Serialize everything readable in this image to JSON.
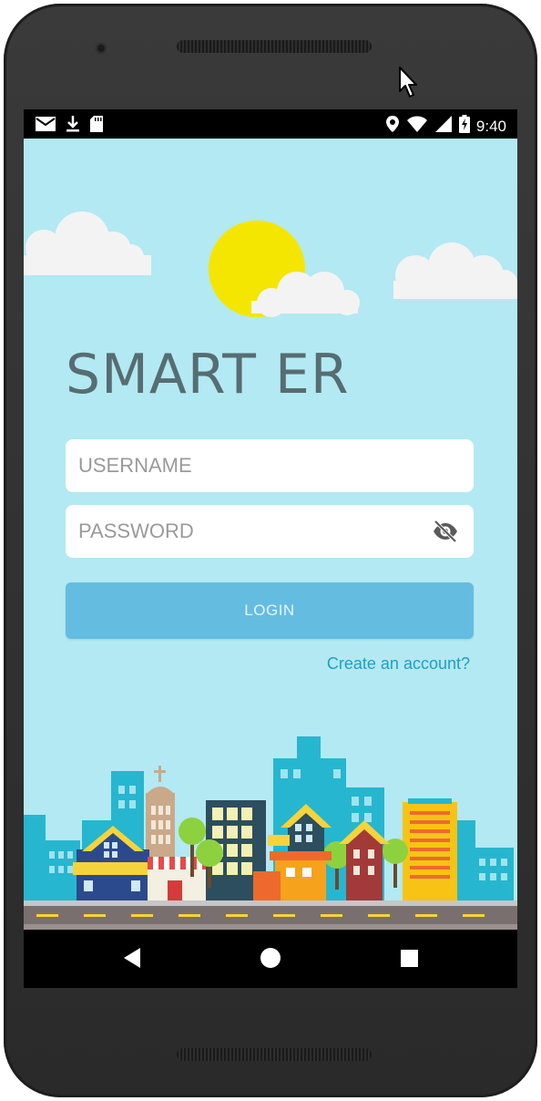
{
  "status_bar": {
    "time": "9:40",
    "left_icons": [
      "gmail-icon",
      "download-icon",
      "sd-card-icon"
    ],
    "right_icons": [
      "location-icon",
      "wifi-icon",
      "signal-icon",
      "battery-charging-icon"
    ]
  },
  "app": {
    "title": "SMART ER",
    "username_placeholder": "USERNAME",
    "password_placeholder": "PASSWORD",
    "login_label": "LOGIN",
    "create_account_link": "Create an account?"
  },
  "nav_bar": {
    "buttons": [
      "back-icon",
      "home-icon",
      "recents-icon"
    ]
  },
  "colors": {
    "sky": "#b3e9f2",
    "title": "#566d72",
    "login_button": "#64bde0",
    "link": "#1e9fc6",
    "sun": "#f4e600"
  }
}
